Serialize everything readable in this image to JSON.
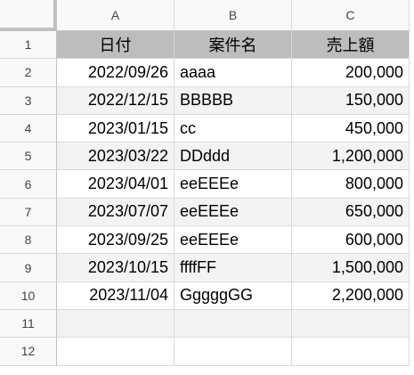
{
  "columns": [
    "A",
    "B",
    "C"
  ],
  "row_numbers": [
    "1",
    "2",
    "3",
    "4",
    "5",
    "6",
    "7",
    "8",
    "9",
    "10",
    "11",
    "12"
  ],
  "header": {
    "date": "日付",
    "case_name": "案件名",
    "sales": "売上額"
  },
  "rows": [
    {
      "date": "2022/09/26",
      "case_name": "aaaa",
      "sales": "200,000"
    },
    {
      "date": "2022/12/15",
      "case_name": "BBBBB",
      "sales": "150,000"
    },
    {
      "date": "2023/01/15",
      "case_name": "cc",
      "sales": "450,000"
    },
    {
      "date": "2023/03/22",
      "case_name": "DDddd",
      "sales": "1,200,000"
    },
    {
      "date": "2023/04/01",
      "case_name": "eeEEEe",
      "sales": "800,000"
    },
    {
      "date": "2023/07/07",
      "case_name": "eeEEEe",
      "sales": "650,000"
    },
    {
      "date": "2023/09/25",
      "case_name": "eeEEEe",
      "sales": "600,000"
    },
    {
      "date": "2023/10/15",
      "case_name": "ffffFF",
      "sales": "1,500,000"
    },
    {
      "date": "2023/11/04",
      "case_name": "GggggGG",
      "sales": "2,200,000"
    }
  ],
  "colors": {
    "header_fill": "#bdbdbd",
    "band_fill": "#f3f3f3",
    "grid_line": "#d9d9d9"
  }
}
